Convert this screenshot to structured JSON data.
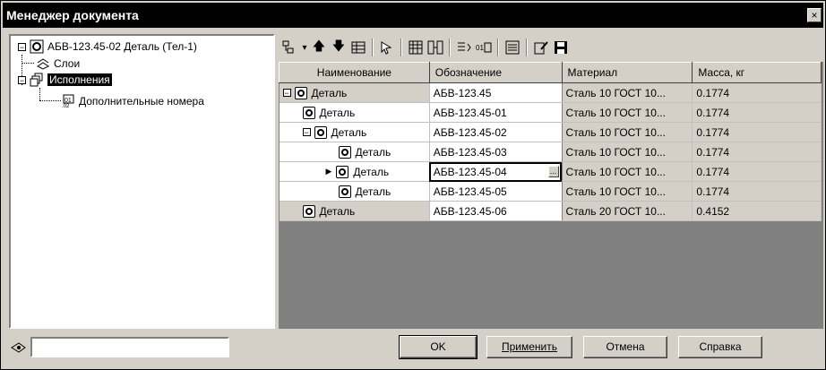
{
  "window": {
    "title": "Менеджер документа",
    "close": "×"
  },
  "tree": {
    "root": "АБВ-123.45-02 Деталь (Тел-1)",
    "layers": "Слои",
    "variants": "Исполнения",
    "extra_numbers": "Дополнительные номера",
    "collapse_symbol": "⊟"
  },
  "toolbar": {
    "icons": [
      "tree-menu-icon",
      "move-up-icon",
      "move-down-icon",
      "structure-icon",
      "pointer-icon",
      "table-icon",
      "split-icon",
      "number-icon",
      "auto-number-icon",
      "list-icon",
      "edit-icon",
      "save-icon"
    ]
  },
  "grid": {
    "headers": [
      "Наименование",
      "Обозначение",
      "Материал",
      "Масса, кг"
    ],
    "rows": [
      {
        "name": "Деталь",
        "designation": "АБВ-123.45",
        "material": "Сталь 10  ГОСТ 10...",
        "mass": "0.1774"
      },
      {
        "name": "Деталь",
        "designation": "АБВ-123.45-01",
        "material": "Сталь 10  ГОСТ 10...",
        "mass": "0.1774"
      },
      {
        "name": "Деталь",
        "designation": "АБВ-123.45-02",
        "material": "Сталь 10  ГОСТ 10...",
        "mass": "0.1774"
      },
      {
        "name": "Деталь",
        "designation": "АБВ-123.45-03",
        "material": "Сталь 10  ГОСТ 10...",
        "mass": "0.1774"
      },
      {
        "name": "Деталь",
        "designation": "АБВ-123.45-04",
        "material": "Сталь 10  ГОСТ 10...",
        "mass": "0.1774"
      },
      {
        "name": "Деталь",
        "designation": "АБВ-123.45-05",
        "material": "Сталь 10  ГОСТ 10...",
        "mass": "0.1774"
      },
      {
        "name": "Деталь",
        "designation": "АБВ-123.45-06",
        "material": "Сталь 20  ГОСТ 10...",
        "mass": "0.4152"
      }
    ],
    "ellipsis": "..."
  },
  "search": {
    "value": ""
  },
  "buttons": {
    "ok": "OK",
    "apply": "Применить",
    "cancel": "Отмена",
    "help": "Справка"
  }
}
